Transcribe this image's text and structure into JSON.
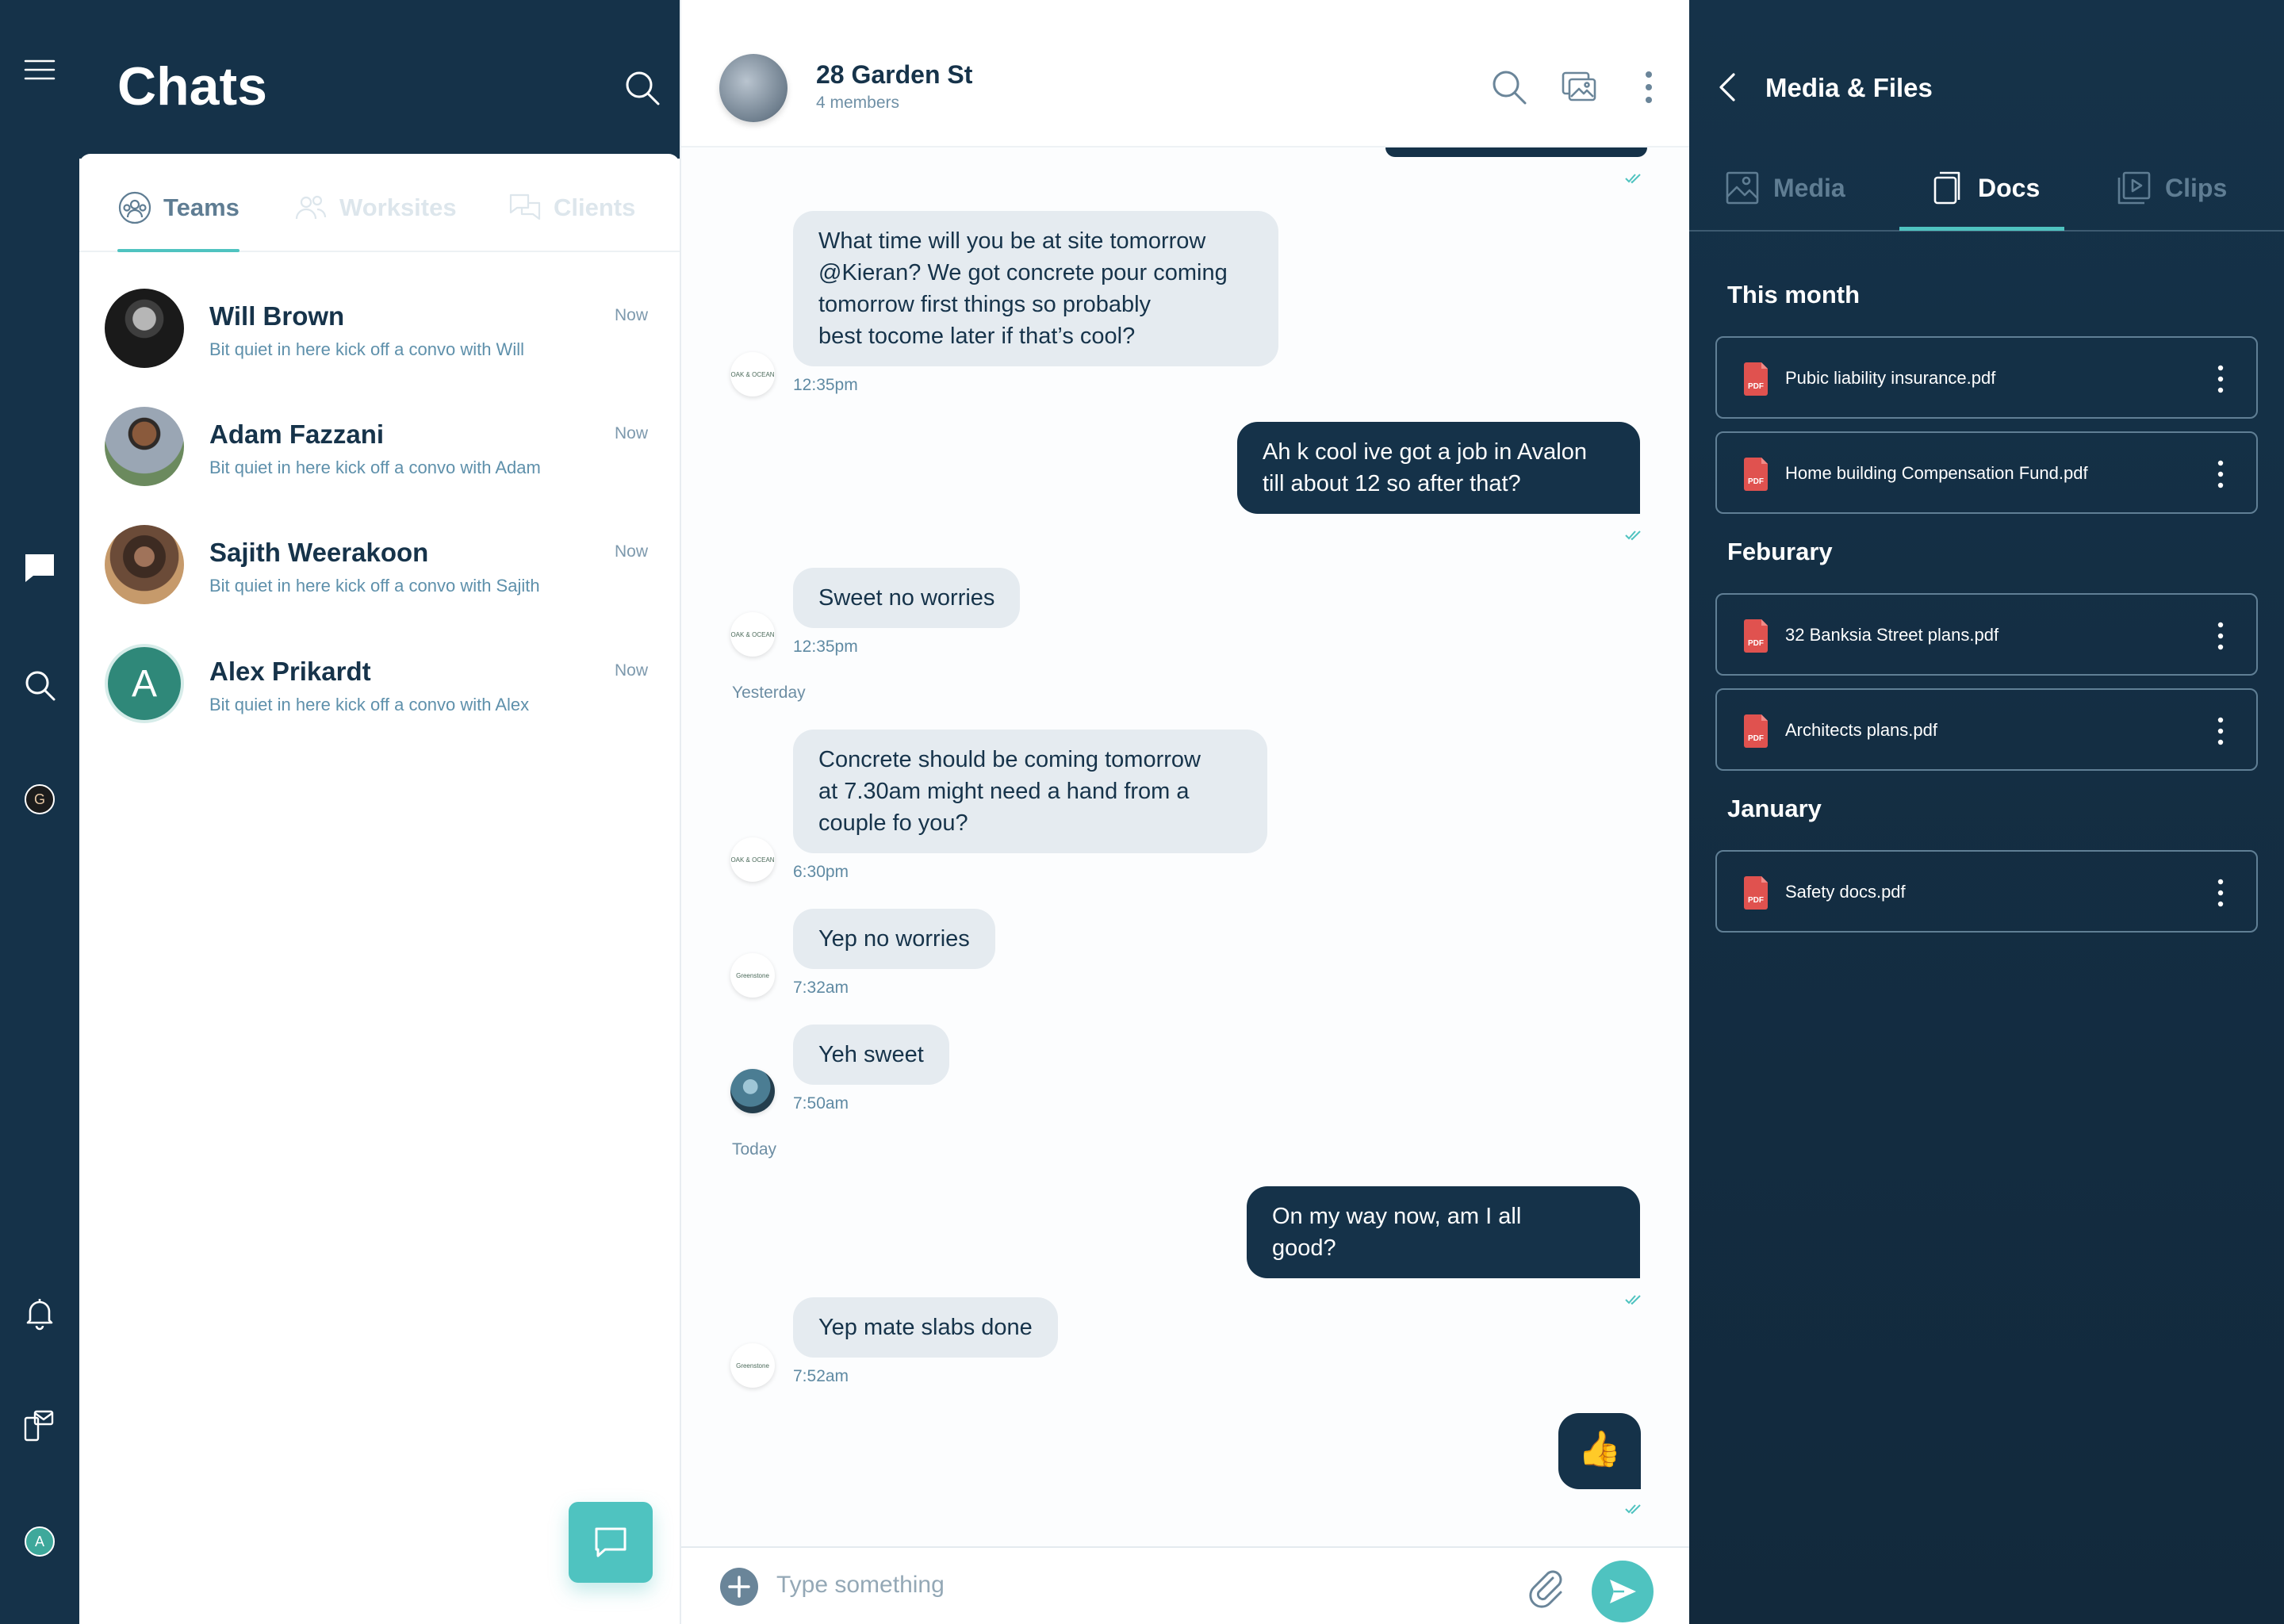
{
  "chats": {
    "title": "Chats",
    "tabs": [
      {
        "label": "Teams",
        "active": true
      },
      {
        "label": "Worksites",
        "active": false
      },
      {
        "label": "Clients",
        "active": false
      }
    ],
    "items": [
      {
        "name": "Will Brown",
        "preview": "Bit quiet in here kick off a convo with Will",
        "time": "Now"
      },
      {
        "name": "Adam Fazzani",
        "preview": "Bit quiet in here kick off a convo with Adam",
        "time": "Now"
      },
      {
        "name": "Sajith Weerakoon",
        "preview": "Bit quiet in here kick off a convo with Sajith",
        "time": "Now"
      },
      {
        "name": "Alex Prikardt",
        "preview": "Bit quiet in here kick off a convo with Alex",
        "time": "Now",
        "initial": "A"
      }
    ]
  },
  "rail": {
    "org_initial": "G",
    "user_initial": "A"
  },
  "conversation": {
    "title": "28 Garden St",
    "subtitle": "4 members",
    "messages": [
      {
        "dir": "in",
        "lines": [
          "What time will you be at site tomorrow",
          "@Kieran? We got concrete pour coming",
          "tomorrow first things so probably",
          "best tocome later if that’s cool?"
        ],
        "time": "12:35pm",
        "avatar_text": "OAK & OCEAN"
      },
      {
        "dir": "out",
        "lines": [
          "Ah k cool ive got a job in Avalon",
          "till about 12 so after that?"
        ]
      },
      {
        "dir": "in",
        "lines": [
          "Sweet no worries"
        ],
        "time": "12:35pm",
        "avatar_text": "OAK & OCEAN"
      },
      {
        "dir": "in",
        "lines": [
          "Concrete should be coming tomorrow",
          "at 7.30am might need a hand from a",
          "couple fo you?"
        ],
        "time": "6:30pm",
        "avatar_text": "OAK & OCEAN"
      },
      {
        "dir": "in",
        "lines": [
          "Yep no worries"
        ],
        "time": "7:32am",
        "avatar_text": "Greenstone"
      },
      {
        "dir": "in",
        "lines": [
          "Yeh sweet"
        ],
        "time": "7:50am"
      },
      {
        "dir": "out",
        "lines": [
          "On my way now, am I all",
          "good?"
        ]
      },
      {
        "dir": "in",
        "lines": [
          "Yep mate slabs done"
        ],
        "time": "7:52am",
        "avatar_text": "Greenstone"
      },
      {
        "dir": "out",
        "lines": [
          "👍"
        ]
      }
    ],
    "day_labels": {
      "yesterday": "Yesterday",
      "today": "Today"
    },
    "composer_placeholder": "Type something"
  },
  "files": {
    "title": "Media & Files",
    "tabs": [
      {
        "label": "Media",
        "active": false
      },
      {
        "label": "Docs",
        "active": true
      },
      {
        "label": "Clips",
        "active": false
      }
    ],
    "sections": [
      {
        "title": "This month",
        "docs": [
          "Pubic liability insurance.pdf",
          "Home building Compensation Fund.pdf"
        ]
      },
      {
        "title": "Feburary",
        "docs": [
          "32 Banksia Street plans.pdf",
          "Architects plans.pdf"
        ]
      },
      {
        "title": "January",
        "docs": [
          "Safety docs.pdf"
        ]
      }
    ],
    "pdf_badge": "PDF"
  },
  "colors": {
    "navy": "#153249",
    "accent": "#4fc3c0",
    "pdf_red": "#e0524f",
    "bubble_in": "#e5ebf0"
  }
}
